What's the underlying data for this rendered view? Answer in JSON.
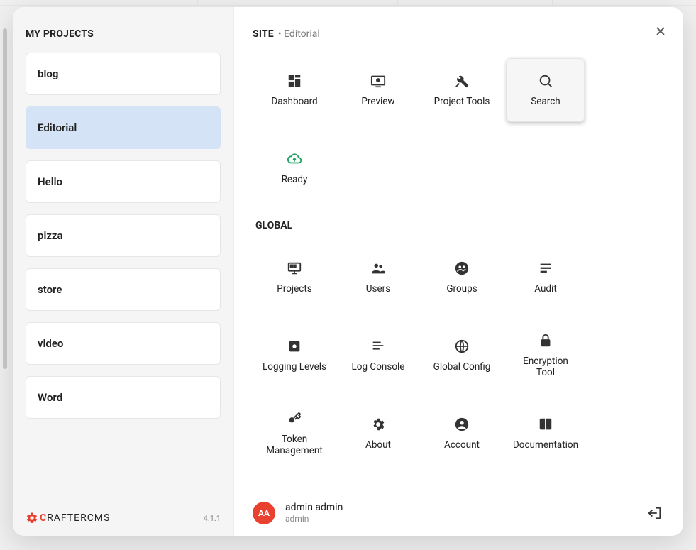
{
  "sidebar": {
    "title": "MY PROJECTS",
    "projects": [
      {
        "name": "blog",
        "active": false
      },
      {
        "name": "Editorial",
        "active": true
      },
      {
        "name": "Hello",
        "active": false
      },
      {
        "name": "pizza",
        "active": false
      },
      {
        "name": "store",
        "active": false
      },
      {
        "name": "video",
        "active": false
      },
      {
        "name": "Word",
        "active": false
      }
    ]
  },
  "brand": {
    "prefix": "C",
    "rest": "RAFTER",
    "suffix": "CMS"
  },
  "version": "4.1.1",
  "site": {
    "label": "SITE",
    "bullet": "•",
    "name": "Editorial"
  },
  "site_tiles": [
    {
      "key": "dashboard",
      "label": "Dashboard",
      "icon": "dashboard"
    },
    {
      "key": "preview",
      "label": "Preview",
      "icon": "preview"
    },
    {
      "key": "project-tools",
      "label": "Project Tools",
      "icon": "tools"
    },
    {
      "key": "search",
      "label": "Search",
      "icon": "search",
      "highlight": true
    },
    {
      "key": "ready",
      "label": "Ready",
      "icon": "cloud-up",
      "green": true
    }
  ],
  "global_label": "GLOBAL",
  "global_tiles": [
    {
      "key": "projects",
      "label": "Projects",
      "icon": "desktop"
    },
    {
      "key": "users",
      "label": "Users",
      "icon": "people"
    },
    {
      "key": "groups",
      "label": "Groups",
      "icon": "group-circle"
    },
    {
      "key": "audit",
      "label": "Audit",
      "icon": "list"
    },
    {
      "key": "logging-levels",
      "label": "Logging Levels",
      "icon": "settings-box"
    },
    {
      "key": "log-console",
      "label": "Log Console",
      "icon": "lines"
    },
    {
      "key": "global-config",
      "label": "Global Config",
      "icon": "globe"
    },
    {
      "key": "encryption-tool",
      "label": "Encryption Tool",
      "icon": "lock"
    },
    {
      "key": "token-management",
      "label": "Token Management",
      "icon": "key"
    },
    {
      "key": "about",
      "label": "About",
      "icon": "gear-c"
    },
    {
      "key": "account",
      "label": "Account",
      "icon": "account"
    },
    {
      "key": "documentation",
      "label": "Documentation",
      "icon": "book"
    }
  ],
  "user": {
    "initials": "AA",
    "display_name": "admin admin",
    "login": "admin"
  }
}
